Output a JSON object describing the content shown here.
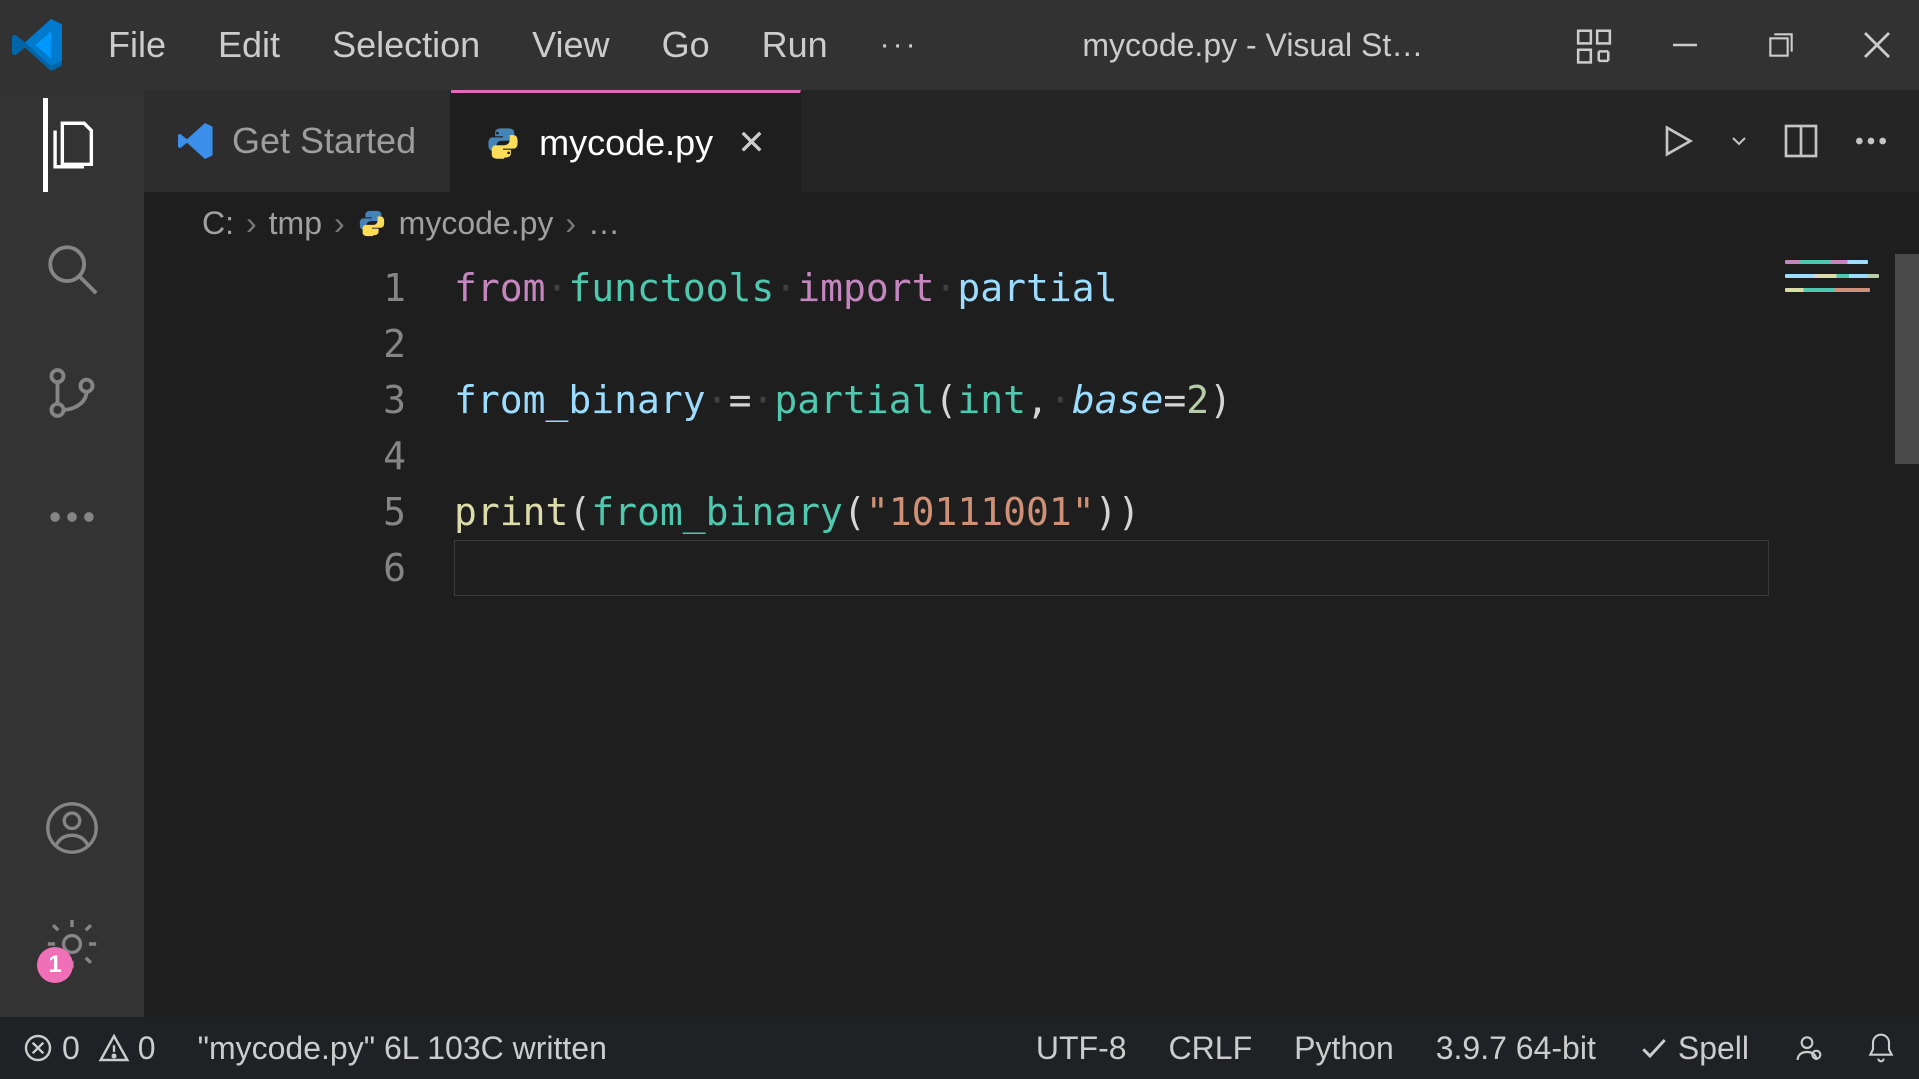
{
  "window": {
    "title": "mycode.py - Visual St…"
  },
  "menu": {
    "file": "File",
    "edit": "Edit",
    "selection": "Selection",
    "view": "View",
    "go": "Go",
    "run": "Run",
    "more": "···"
  },
  "tabs": {
    "get_started": "Get Started",
    "mycode": "mycode.py"
  },
  "breadcrumb": {
    "drive": "C:",
    "folder": "tmp",
    "file": "mycode.py",
    "symbol": "…"
  },
  "code": {
    "lines": [
      "1",
      "2",
      "3",
      "4",
      "5",
      "6"
    ],
    "line1": {
      "from": "from",
      "module": "functools",
      "import": "import",
      "name": "partial"
    },
    "line3": {
      "lhs": "from_binary",
      "eq": "=",
      "fn": "partial",
      "int": "int",
      "base": "base",
      "beq": "=",
      "two": "2"
    },
    "line5": {
      "print": "print",
      "fn": "from_binary",
      "str": "\"10111001\""
    }
  },
  "status": {
    "errors": "0",
    "warnings": "0",
    "message": "\"mycode.py\" 6L 103C written",
    "encoding": "UTF-8",
    "eol": "CRLF",
    "lang": "Python",
    "interpreter": "3.9.7 64-bit",
    "spell": "Spell"
  },
  "colors": {
    "accent_pink": "#e06bb5",
    "badge_pink": "#f070b7"
  },
  "settings_badge": "1"
}
